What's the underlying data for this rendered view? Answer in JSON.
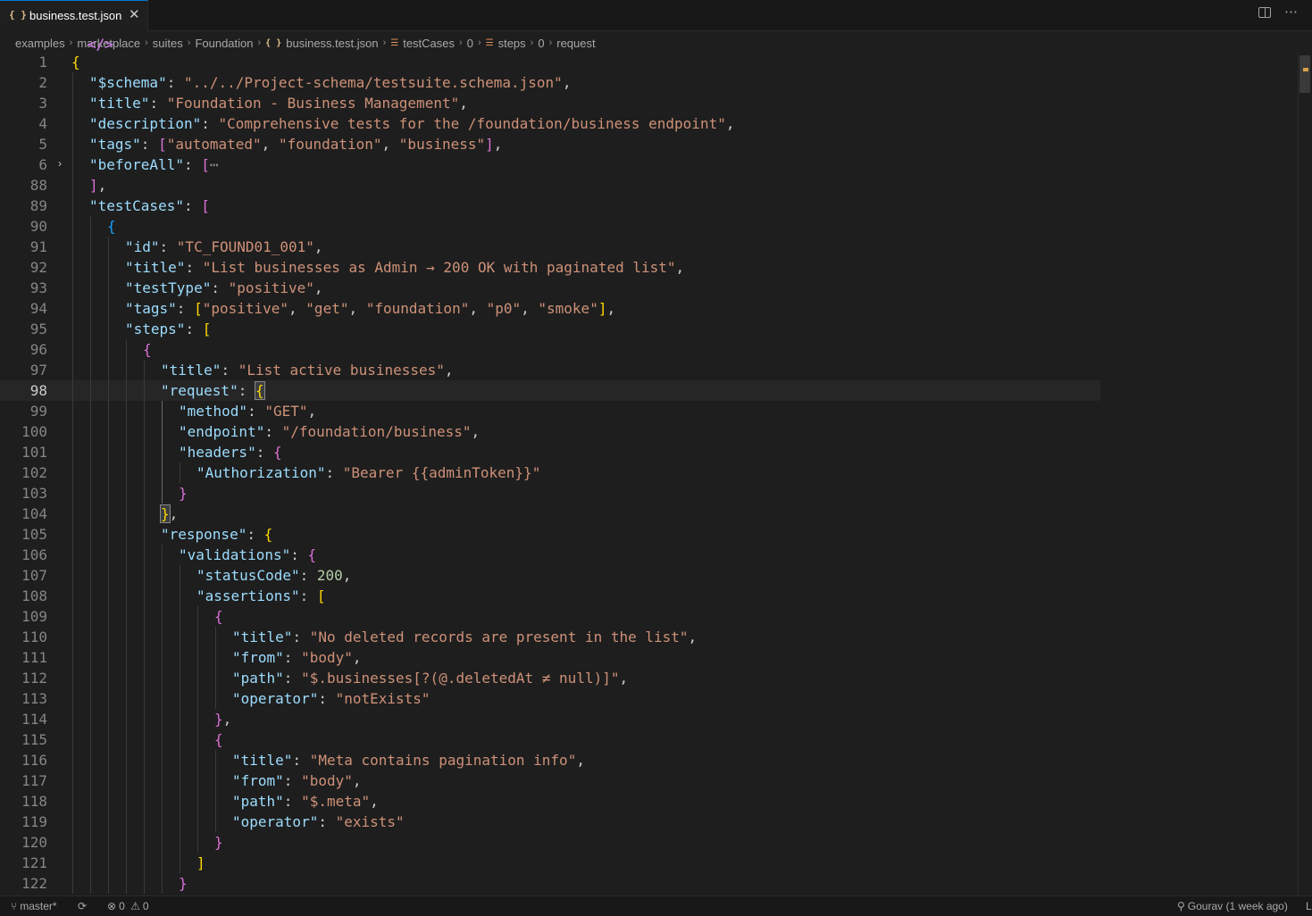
{
  "tab": {
    "icon": "json-braces-icon",
    "label": "business.test.json",
    "close": "✕"
  },
  "title_actions": {
    "split_editor": "split-editor-icon",
    "more": "⋯"
  },
  "breadcrumb": [
    {
      "label": "examples",
      "icon": null
    },
    {
      "label": "marketplace",
      "icon": null
    },
    {
      "label": "suites",
      "icon": null
    },
    {
      "label": "Foundation",
      "icon": null
    },
    {
      "label": "business.test.json",
      "icon": "json"
    },
    {
      "label": "testCases",
      "icon": "arr"
    },
    {
      "label": "0",
      "icon": "code"
    },
    {
      "label": "steps",
      "icon": "arr"
    },
    {
      "label": "0",
      "icon": "code"
    },
    {
      "label": "request",
      "icon": "code"
    }
  ],
  "editor": {
    "active_line": "98",
    "lines": [
      {
        "n": "1",
        "indent": 0,
        "t": [
          [
            "b1",
            "{"
          ]
        ]
      },
      {
        "n": "2",
        "indent": 1,
        "t": [
          [
            "k",
            "\"$schema\""
          ],
          [
            "p",
            ": "
          ],
          [
            "s",
            "\"../../Project-schema/testsuite.schema.json\""
          ],
          [
            "p",
            ","
          ]
        ]
      },
      {
        "n": "3",
        "indent": 1,
        "t": [
          [
            "k",
            "\"title\""
          ],
          [
            "p",
            ": "
          ],
          [
            "s",
            "\"Foundation - Business Management\""
          ],
          [
            "p",
            ","
          ]
        ]
      },
      {
        "n": "4",
        "indent": 1,
        "t": [
          [
            "k",
            "\"description\""
          ],
          [
            "p",
            ": "
          ],
          [
            "s",
            "\"Comprehensive tests for the /foundation/business endpoint\""
          ],
          [
            "p",
            ","
          ]
        ]
      },
      {
        "n": "5",
        "indent": 1,
        "t": [
          [
            "k",
            "\"tags\""
          ],
          [
            "p",
            ": "
          ],
          [
            "b2",
            "["
          ],
          [
            "s",
            "\"automated\""
          ],
          [
            "p",
            ", "
          ],
          [
            "s",
            "\"foundation\""
          ],
          [
            "p",
            ", "
          ],
          [
            "s",
            "\"business\""
          ],
          [
            "b2",
            "]"
          ],
          [
            "p",
            ","
          ]
        ]
      },
      {
        "n": "6",
        "indent": 1,
        "fold": true,
        "t": [
          [
            "k",
            "\"beforeAll\""
          ],
          [
            "p",
            ": "
          ],
          [
            "b2",
            "["
          ],
          [
            "ellip",
            "⋯"
          ]
        ]
      },
      {
        "n": "88",
        "indent": 1,
        "t": [
          [
            "b2",
            "]"
          ],
          [
            "p",
            ","
          ]
        ]
      },
      {
        "n": "89",
        "indent": 1,
        "t": [
          [
            "k",
            "\"testCases\""
          ],
          [
            "p",
            ": "
          ],
          [
            "b2",
            "["
          ]
        ]
      },
      {
        "n": "90",
        "indent": 2,
        "t": [
          [
            "b3",
            "{"
          ]
        ]
      },
      {
        "n": "91",
        "indent": 3,
        "t": [
          [
            "k",
            "\"id\""
          ],
          [
            "p",
            ": "
          ],
          [
            "s",
            "\"TC_FOUND01_001\""
          ],
          [
            "p",
            ","
          ]
        ]
      },
      {
        "n": "92",
        "indent": 3,
        "t": [
          [
            "k",
            "\"title\""
          ],
          [
            "p",
            ": "
          ],
          [
            "s",
            "\"List businesses as Admin → 200 OK with paginated list\""
          ],
          [
            "p",
            ","
          ]
        ]
      },
      {
        "n": "93",
        "indent": 3,
        "t": [
          [
            "k",
            "\"testType\""
          ],
          [
            "p",
            ": "
          ],
          [
            "s",
            "\"positive\""
          ],
          [
            "p",
            ","
          ]
        ]
      },
      {
        "n": "94",
        "indent": 3,
        "t": [
          [
            "k",
            "\"tags\""
          ],
          [
            "p",
            ": "
          ],
          [
            "b1",
            "["
          ],
          [
            "s",
            "\"positive\""
          ],
          [
            "p",
            ", "
          ],
          [
            "s",
            "\"get\""
          ],
          [
            "p",
            ", "
          ],
          [
            "s",
            "\"foundation\""
          ],
          [
            "p",
            ", "
          ],
          [
            "s",
            "\"p0\""
          ],
          [
            "p",
            ", "
          ],
          [
            "s",
            "\"smoke\""
          ],
          [
            "b1",
            "]"
          ],
          [
            "p",
            ","
          ]
        ]
      },
      {
        "n": "95",
        "indent": 3,
        "t": [
          [
            "k",
            "\"steps\""
          ],
          [
            "p",
            ": "
          ],
          [
            "b1",
            "["
          ]
        ]
      },
      {
        "n": "96",
        "indent": 4,
        "t": [
          [
            "b2",
            "{"
          ]
        ]
      },
      {
        "n": "97",
        "indent": 5,
        "t": [
          [
            "k",
            "\"title\""
          ],
          [
            "p",
            ": "
          ],
          [
            "s",
            "\"List active businesses\""
          ],
          [
            "p",
            ","
          ]
        ]
      },
      {
        "n": "98",
        "indent": 5,
        "hl": true,
        "t": [
          [
            "k",
            "\"request\""
          ],
          [
            "p",
            ": "
          ],
          [
            "b3c",
            "{"
          ]
        ]
      },
      {
        "n": "99",
        "indent": 6,
        "t": [
          [
            "k",
            "\"method\""
          ],
          [
            "p",
            ": "
          ],
          [
            "s",
            "\"GET\""
          ],
          [
            "p",
            ","
          ]
        ]
      },
      {
        "n": "100",
        "indent": 6,
        "t": [
          [
            "k",
            "\"endpoint\""
          ],
          [
            "p",
            ": "
          ],
          [
            "s",
            "\"/foundation/business\""
          ],
          [
            "p",
            ","
          ]
        ]
      },
      {
        "n": "101",
        "indent": 6,
        "t": [
          [
            "k",
            "\"headers\""
          ],
          [
            "p",
            ": "
          ],
          [
            "b2",
            "{"
          ]
        ]
      },
      {
        "n": "102",
        "indent": 7,
        "t": [
          [
            "k",
            "\"Authorization\""
          ],
          [
            "p",
            ": "
          ],
          [
            "s",
            "\"Bearer {{adminToken}}\""
          ]
        ]
      },
      {
        "n": "103",
        "indent": 6,
        "t": [
          [
            "b2",
            "}"
          ]
        ]
      },
      {
        "n": "104",
        "indent": 5,
        "t": [
          [
            "b3c",
            "}"
          ],
          [
            "p",
            ","
          ]
        ]
      },
      {
        "n": "105",
        "indent": 5,
        "t": [
          [
            "k",
            "\"response\""
          ],
          [
            "p",
            ": "
          ],
          [
            "b1",
            "{"
          ]
        ]
      },
      {
        "n": "106",
        "indent": 6,
        "t": [
          [
            "k",
            "\"validations\""
          ],
          [
            "p",
            ": "
          ],
          [
            "b2",
            "{"
          ]
        ]
      },
      {
        "n": "107",
        "indent": 7,
        "t": [
          [
            "k",
            "\"statusCode\""
          ],
          [
            "p",
            ": "
          ],
          [
            "n",
            "200"
          ],
          [
            "p",
            ","
          ]
        ]
      },
      {
        "n": "108",
        "indent": 7,
        "t": [
          [
            "k",
            "\"assertions\""
          ],
          [
            "p",
            ": "
          ],
          [
            "b1",
            "["
          ]
        ]
      },
      {
        "n": "109",
        "indent": 8,
        "t": [
          [
            "b2",
            "{"
          ]
        ]
      },
      {
        "n": "110",
        "indent": 9,
        "t": [
          [
            "k",
            "\"title\""
          ],
          [
            "p",
            ": "
          ],
          [
            "s",
            "\"No deleted records are present in the list\""
          ],
          [
            "p",
            ","
          ]
        ]
      },
      {
        "n": "111",
        "indent": 9,
        "t": [
          [
            "k",
            "\"from\""
          ],
          [
            "p",
            ": "
          ],
          [
            "s",
            "\"body\""
          ],
          [
            "p",
            ","
          ]
        ]
      },
      {
        "n": "112",
        "indent": 9,
        "t": [
          [
            "k",
            "\"path\""
          ],
          [
            "p",
            ": "
          ],
          [
            "s",
            "\"$.businesses[?(@.deletedAt ≠ null)]\""
          ],
          [
            "p",
            ","
          ]
        ]
      },
      {
        "n": "113",
        "indent": 9,
        "t": [
          [
            "k",
            "\"operator\""
          ],
          [
            "p",
            ": "
          ],
          [
            "s",
            "\"notExists\""
          ]
        ]
      },
      {
        "n": "114",
        "indent": 8,
        "t": [
          [
            "b2",
            "}"
          ],
          [
            "p",
            ","
          ]
        ]
      },
      {
        "n": "115",
        "indent": 8,
        "t": [
          [
            "b2",
            "{"
          ]
        ]
      },
      {
        "n": "116",
        "indent": 9,
        "t": [
          [
            "k",
            "\"title\""
          ],
          [
            "p",
            ": "
          ],
          [
            "s",
            "\"Meta contains pagination info\""
          ],
          [
            "p",
            ","
          ]
        ]
      },
      {
        "n": "117",
        "indent": 9,
        "t": [
          [
            "k",
            "\"from\""
          ],
          [
            "p",
            ": "
          ],
          [
            "s",
            "\"body\""
          ],
          [
            "p",
            ","
          ]
        ]
      },
      {
        "n": "118",
        "indent": 9,
        "t": [
          [
            "k",
            "\"path\""
          ],
          [
            "p",
            ": "
          ],
          [
            "s",
            "\"$.meta\""
          ],
          [
            "p",
            ","
          ]
        ]
      },
      {
        "n": "119",
        "indent": 9,
        "t": [
          [
            "k",
            "\"operator\""
          ],
          [
            "p",
            ": "
          ],
          [
            "s",
            "\"exists\""
          ]
        ]
      },
      {
        "n": "120",
        "indent": 8,
        "t": [
          [
            "b2",
            "}"
          ]
        ]
      },
      {
        "n": "121",
        "indent": 7,
        "t": [
          [
            "b1",
            "]"
          ]
        ]
      },
      {
        "n": "122",
        "indent": 6,
        "t": [
          [
            "b2",
            "}"
          ]
        ]
      }
    ]
  },
  "status": {
    "branch": "master*",
    "errors": "0",
    "warnings": "0",
    "blame": "Gourav (1 week ago)",
    "right_edge": "L"
  }
}
